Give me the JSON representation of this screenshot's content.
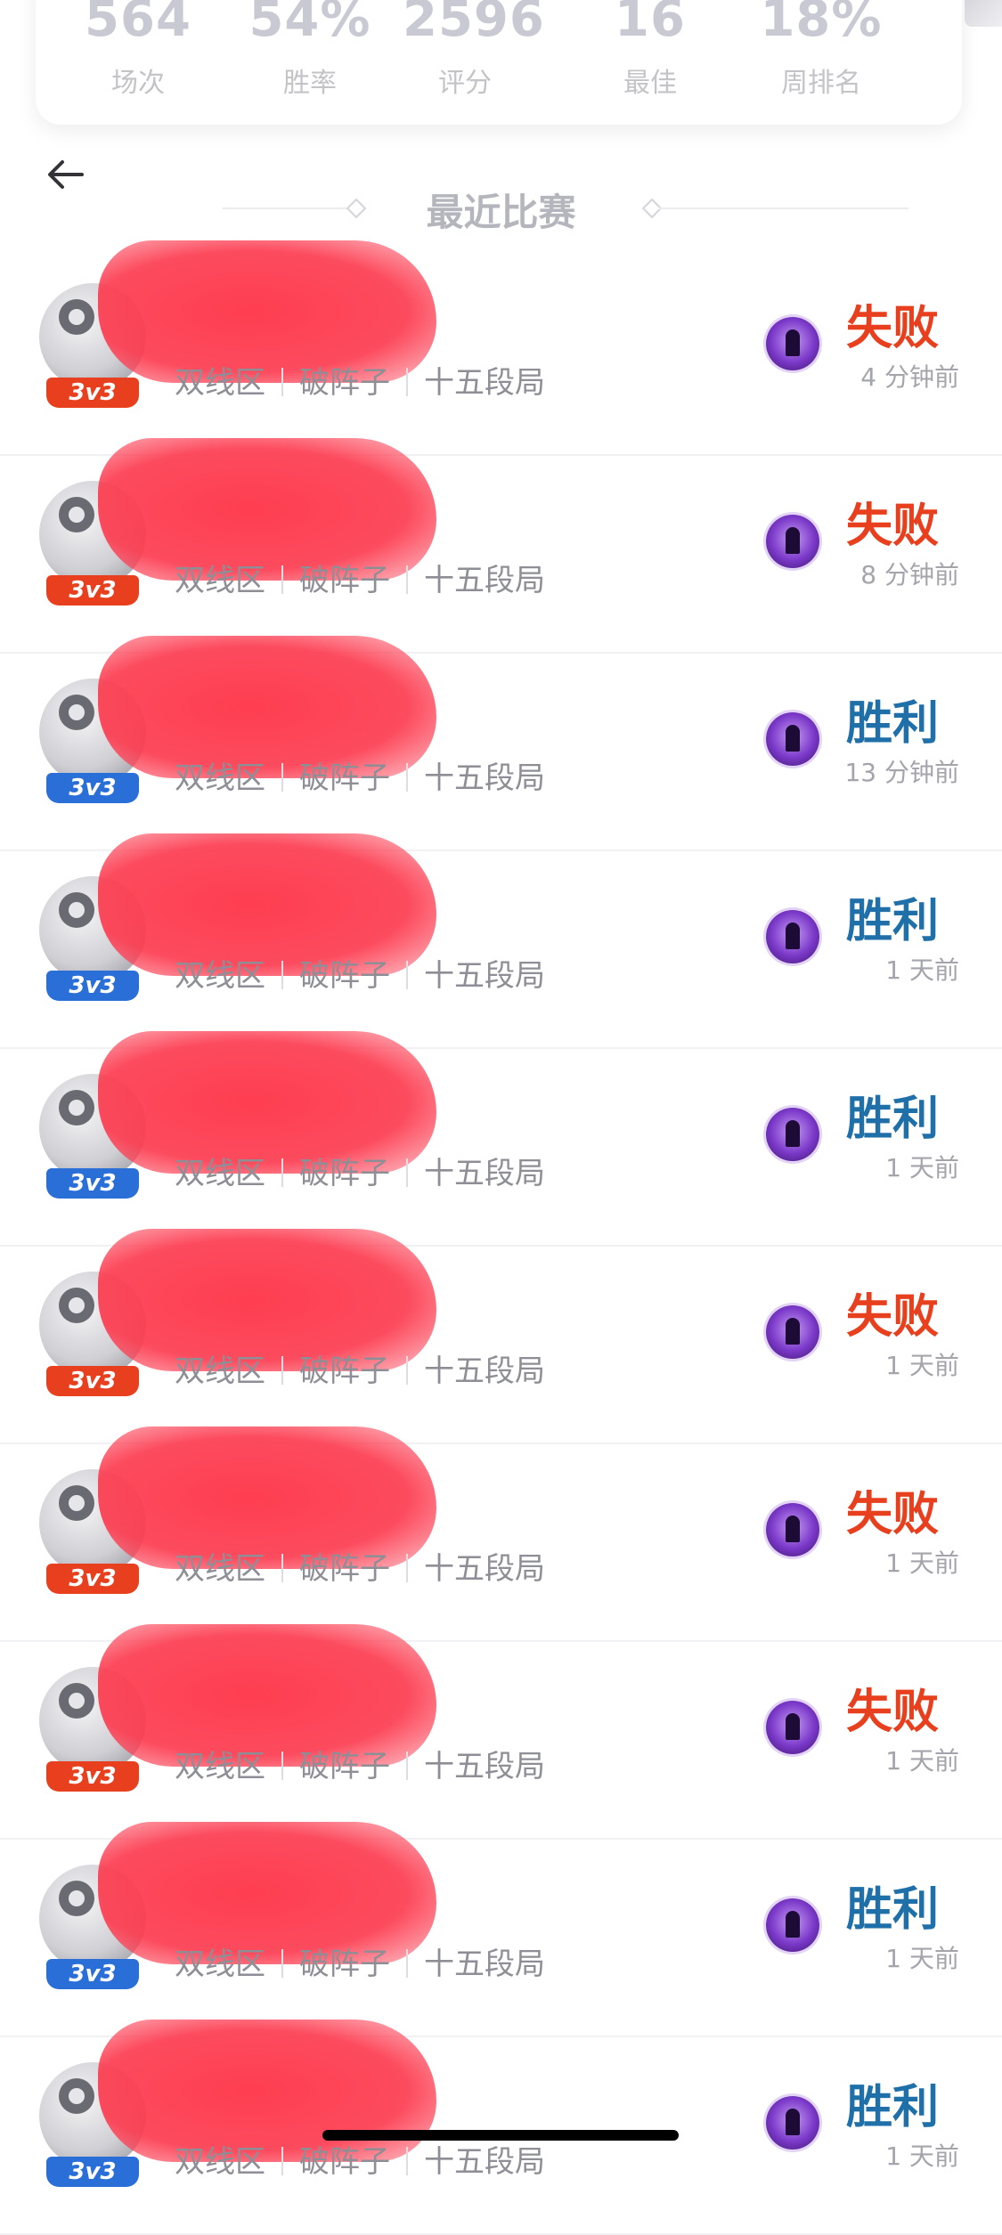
{
  "stats": [
    {
      "value": "564",
      "label": "场次"
    },
    {
      "value": "54%",
      "label": "胜率"
    },
    {
      "value": "2596",
      "label": "评分"
    },
    {
      "value": "16",
      "label": "最佳"
    },
    {
      "value": "18%",
      "label": "周排名"
    }
  ],
  "header": {
    "back_icon": "arrow-left-icon",
    "title": "最近比赛"
  },
  "colors": {
    "lose": "#e8401f",
    "win": "#1f6fa8",
    "badge_lose": "#e8401f",
    "badge_win": "#2a6ed8",
    "redaction": "#ff3a4e"
  },
  "matches": [
    {
      "mode": "3v3",
      "zone": "双线区",
      "position": "破阵子",
      "rank": "十五段局",
      "result": "失败",
      "outcome": "lose",
      "time": "4 分钟前"
    },
    {
      "mode": "3v3",
      "zone": "双线区",
      "position": "破阵子",
      "rank": "十五段局",
      "result": "失败",
      "outcome": "lose",
      "time": "8 分钟前"
    },
    {
      "mode": "3v3",
      "zone": "双线区",
      "position": "破阵子",
      "rank": "十五段局",
      "result": "胜利",
      "outcome": "win",
      "time": "13 分钟前"
    },
    {
      "mode": "3v3",
      "zone": "双线区",
      "position": "破阵子",
      "rank": "十五段局",
      "result": "胜利",
      "outcome": "win",
      "time": "1 天前"
    },
    {
      "mode": "3v3",
      "zone": "双线区",
      "position": "破阵子",
      "rank": "十五段局",
      "result": "胜利",
      "outcome": "win",
      "time": "1 天前"
    },
    {
      "mode": "3v3",
      "zone": "双线区",
      "position": "破阵子",
      "rank": "十五段局",
      "result": "失败",
      "outcome": "lose",
      "time": "1 天前"
    },
    {
      "mode": "3v3",
      "zone": "双线区",
      "position": "破阵子",
      "rank": "十五段局",
      "result": "失败",
      "outcome": "lose",
      "time": "1 天前"
    },
    {
      "mode": "3v3",
      "zone": "双线区",
      "position": "破阵子",
      "rank": "十五段局",
      "result": "失败",
      "outcome": "lose",
      "time": "1 天前"
    },
    {
      "mode": "3v3",
      "zone": "双线区",
      "position": "破阵子",
      "rank": "十五段局",
      "result": "胜利",
      "outcome": "win",
      "time": "1 天前"
    },
    {
      "mode": "3v3",
      "zone": "双线区",
      "position": "破阵子",
      "rank": "十五段局",
      "result": "胜利",
      "outcome": "win",
      "time": "1 天前"
    }
  ]
}
